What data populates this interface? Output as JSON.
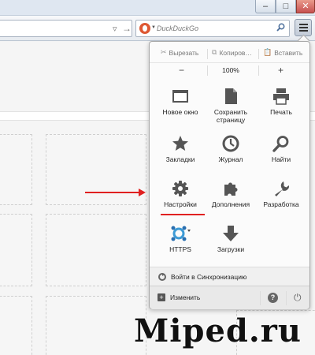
{
  "browser": {
    "search_placeholder": "DuckDuckGo",
    "window_buttons": {
      "minimize": "–",
      "maximize": "□",
      "close": "✕"
    }
  },
  "menu": {
    "edit": {
      "cut": "Вырезать",
      "copy": "Копиров…",
      "paste": "Вставить"
    },
    "zoom": {
      "minus": "−",
      "value": "100%",
      "plus": "+"
    },
    "items": [
      {
        "label": "Новое окно",
        "icon": "new-window-icon"
      },
      {
        "label": "Сохранить страницу",
        "icon": "save-page-icon"
      },
      {
        "label": "Печать",
        "icon": "print-icon"
      },
      {
        "label": "Закладки",
        "icon": "bookmarks-star-icon"
      },
      {
        "label": "Журнал",
        "icon": "history-clock-icon"
      },
      {
        "label": "Найти",
        "icon": "find-magnifier-icon"
      },
      {
        "label": "Настройки",
        "icon": "settings-gear-icon"
      },
      {
        "label": "Дополнения",
        "icon": "addons-puzzle-icon"
      },
      {
        "label": "Разработка",
        "icon": "developer-wrench-icon"
      },
      {
        "label": "HTTPS",
        "icon": "https-everywhere-icon"
      },
      {
        "label": "Загрузки",
        "icon": "downloads-arrow-icon"
      }
    ],
    "sync": "Войти в Синхронизацию",
    "customize": "Изменить",
    "help": "?",
    "quit": "⏻"
  },
  "watermark": "Miped.ru",
  "colors": {
    "annotation": "#e02020",
    "icon_dark": "#555555",
    "https_icon": "#3d9bd6"
  }
}
